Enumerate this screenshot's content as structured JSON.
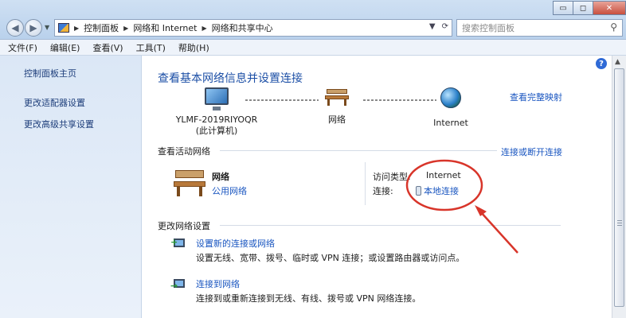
{
  "window": {
    "minimize_glyph": "▭",
    "maximize_glyph": "◻",
    "close_glyph": "✕"
  },
  "address_bar": {
    "crumbs": [
      "控制面板",
      "网络和 Internet",
      "网络和共享中心"
    ],
    "search_placeholder": "搜索控制面板"
  },
  "menu": {
    "items": [
      "文件(F)",
      "编辑(E)",
      "查看(V)",
      "工具(T)",
      "帮助(H)"
    ]
  },
  "sidebar": {
    "items": [
      {
        "label": "控制面板主页"
      },
      {
        "label": "更改适配器设置"
      },
      {
        "label": "更改高级共享设置"
      }
    ]
  },
  "main": {
    "title": "查看基本网络信息并设置连接",
    "full_map_link": "查看完整映射",
    "map": {
      "computer_name": "YLMF-2019RIYOQR",
      "computer_sub": "(此计算机)",
      "network_label": "网络",
      "internet_label": "Internet"
    },
    "active_section": {
      "title": "查看活动网络",
      "connect_link": "连接或断开连接",
      "network_name": "网络",
      "network_type": "公用网络",
      "access_type_label": "访问类型:",
      "access_type_value": "Internet",
      "connections_label": "连接:",
      "connections_value": "本地连接"
    },
    "change_section": {
      "title": "更改网络设置",
      "tasks": [
        {
          "title": "设置新的连接或网络",
          "desc": "设置无线、宽带、拨号、临时或 VPN 连接；或设置路由器或访问点。"
        },
        {
          "title": "连接到网络",
          "desc": "连接到或重新连接到无线、有线、拨号或 VPN 网络连接。"
        }
      ]
    }
  },
  "annotation_color": "#d8352a"
}
